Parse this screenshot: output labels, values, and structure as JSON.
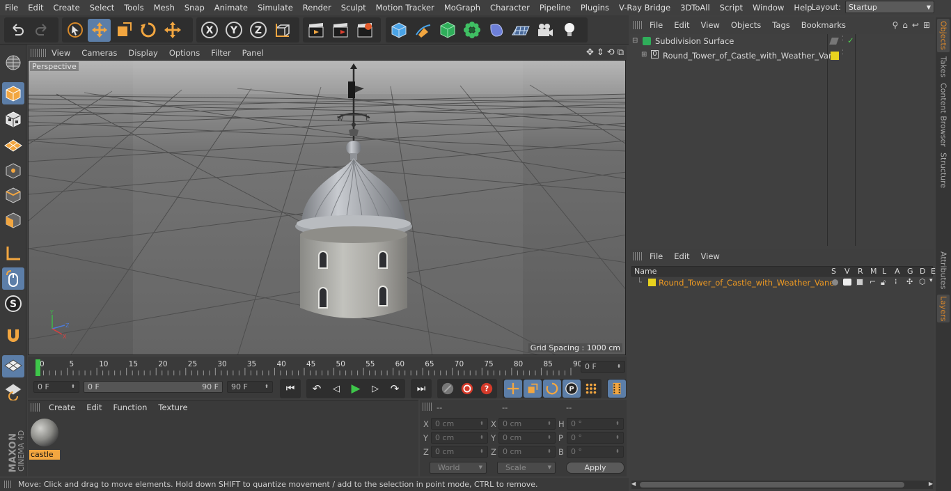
{
  "menubar": {
    "items": [
      "File",
      "Edit",
      "Create",
      "Select",
      "Tools",
      "Mesh",
      "Snap",
      "Animate",
      "Simulate",
      "Render",
      "Sculpt",
      "Motion Tracker",
      "MoGraph",
      "Character",
      "Pipeline",
      "Plugins",
      "V-Ray Bridge",
      "3DToAll",
      "Script",
      "Window",
      "Help"
    ],
    "layout_label": "Layout:",
    "layout_value": "Startup"
  },
  "toolbar": {
    "axis_x": "X",
    "axis_y": "Y",
    "axis_z": "Z"
  },
  "viewport": {
    "menu": [
      "View",
      "Cameras",
      "Display",
      "Options",
      "Filter",
      "Panel"
    ],
    "label": "Perspective",
    "grid_spacing": "Grid Spacing : 1000 cm"
  },
  "timeline": {
    "ticks": [
      "0",
      "5",
      "10",
      "15",
      "20",
      "25",
      "30",
      "35",
      "40",
      "45",
      "50",
      "55",
      "60",
      "65",
      "70",
      "75",
      "80",
      "85",
      "90"
    ],
    "current_frame": "0 F"
  },
  "playbar": {
    "start_frame": "0 F",
    "range_start": "0 F",
    "range_end": "90 F",
    "end_frame": "90 F"
  },
  "material_manager": {
    "menu": [
      "Create",
      "Edit",
      "Function",
      "Texture"
    ],
    "material_name": "castle"
  },
  "coordinates": {
    "headers": [
      "--",
      "--",
      "--"
    ],
    "rows": [
      {
        "l1": "X",
        "v1": "0 cm",
        "l2": "X",
        "v2": "0 cm",
        "l3": "H",
        "v3": "0 °"
      },
      {
        "l1": "Y",
        "v1": "0 cm",
        "l2": "Y",
        "v2": "0 cm",
        "l3": "P",
        "v3": "0 °"
      },
      {
        "l1": "Z",
        "v1": "0 cm",
        "l2": "Z",
        "v2": "0 cm",
        "l3": "B",
        "v3": "0 °"
      }
    ],
    "world": "World",
    "scale": "Scale",
    "apply": "Apply"
  },
  "status_bar": "Move: Click and drag to move elements. Hold down SHIFT to quantize movement / add to the selection in point mode, CTRL to remove.",
  "object_manager": {
    "menu": [
      "File",
      "Edit",
      "View",
      "Objects",
      "Tags",
      "Bookmarks"
    ],
    "objects": [
      {
        "name": "Subdivision Surface"
      },
      {
        "name": "Round_Tower_of_Castle_with_Weather_Vane"
      }
    ]
  },
  "layer_manager": {
    "menu": [
      "File",
      "Edit",
      "View"
    ],
    "columns": [
      "Name",
      "S",
      "V",
      "R",
      "M",
      "L",
      "A",
      "G",
      "D",
      "E"
    ],
    "layers": [
      {
        "name": "Round_Tower_of_Castle_with_Weather_Vane",
        "color": "#e8d21e"
      }
    ]
  },
  "side_tabs": {
    "top": [
      "Objects",
      "Takes",
      "Content Browser",
      "Structure"
    ],
    "bottom": [
      "Attributes",
      "Layers"
    ]
  },
  "branding": {
    "maxon": "MAXON",
    "product": "CINEMA 4D"
  }
}
